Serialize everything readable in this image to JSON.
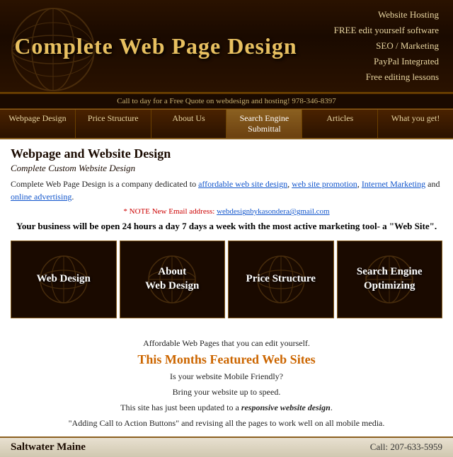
{
  "header": {
    "title": "Complete Web Page Design",
    "services": [
      "Website Hosting",
      "FREE edit yourself software",
      "SEO / Marketing",
      "PayPal  Integrated",
      "Free editing lessons"
    ]
  },
  "call_bar": "Call to day for a Free Quote on webdesign and hosting!  978-346-8397",
  "nav": {
    "items": [
      {
        "label": "Webpage Design",
        "active": false
      },
      {
        "label": "Price Structure",
        "active": false
      },
      {
        "label": "About Us",
        "active": false
      },
      {
        "label": "Search Engine Submittal",
        "active": true
      },
      {
        "label": "Articles",
        "active": false
      },
      {
        "label": "What you get!",
        "active": false
      }
    ]
  },
  "main": {
    "heading": "Webpage and Website Design",
    "subtitle": "Complete Custom Website Design",
    "intro_text": "Complete Web Page Design is a company dedicated to ",
    "intro_links": [
      "affordable web site design",
      "web site promotion",
      "Internet Marketing"
    ],
    "intro_and": " and ",
    "intro_last_link": "online advertising",
    "intro_end": ".",
    "note_prefix": "* NOTE New Email address: ",
    "note_email": "webdesignbykasondera@gmail.com",
    "open_line": "Your business will be open 24 hours a day 7 days a week with the most active marketing tool- a \"Web Site\".",
    "boxes": [
      {
        "label": "Web Design"
      },
      {
        "label": "About\nWeb Design"
      },
      {
        "label": "Price Structure"
      },
      {
        "label": "Search Engine\nOptimizing"
      }
    ]
  },
  "bottom": {
    "line1": "Affordable Web Pages that you can edit yourself.",
    "featured": "This Months Featured Web Sites",
    "line2": "Is your website Mobile Friendly?",
    "line3": "Bring your website up to speed.",
    "line4_prefix": "This site has just been updated to a ",
    "line4_italic": "responsive website design",
    "line4_end": ".",
    "line5": "\"Adding Call to Action Buttons\"  and revising all the pages to work well on all mobile media."
  },
  "footer": {
    "site_name": "Saltwater Maine",
    "call_label": "Call:",
    "phone": "207-633-5959"
  }
}
